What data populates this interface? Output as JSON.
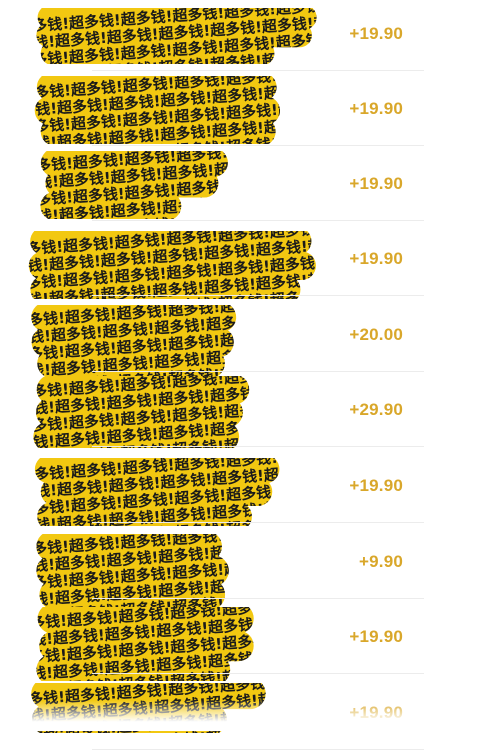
{
  "transactions": [
    {
      "amount": "+19.90"
    },
    {
      "amount": "+19.90"
    },
    {
      "amount": "+19.90"
    },
    {
      "amount": "+19.90"
    },
    {
      "amount": "+20.00"
    },
    {
      "amount": "+29.90"
    },
    {
      "amount": "+19.90"
    },
    {
      "amount": "+9.90"
    },
    {
      "amount": "+19.90"
    },
    {
      "amount": "+19.90"
    }
  ],
  "redaction_watermark": "超多钱!",
  "colors": {
    "amount": "#d9a72a",
    "redaction_fill": "#f2c811",
    "redaction_ink": "#1a1a1a",
    "divider": "#ececec"
  }
}
